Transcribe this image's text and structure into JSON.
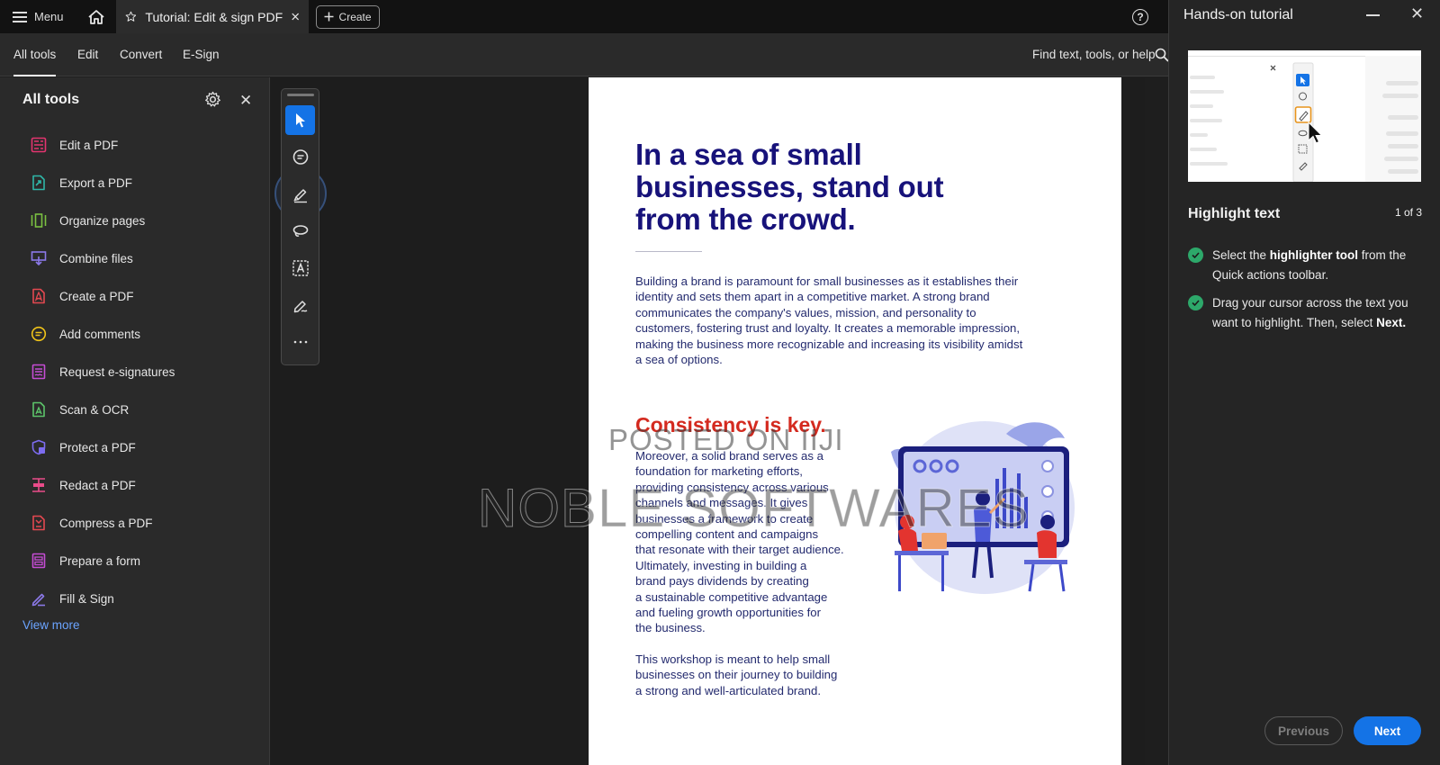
{
  "topbar": {
    "menu_label": "Menu",
    "tab_title": "Tutorial: Edit & sign PDF",
    "create_label": "Create",
    "help_symbol": "?"
  },
  "toolbar": {
    "tabs": [
      {
        "label": "All tools",
        "active": true
      },
      {
        "label": "Edit",
        "active": false
      },
      {
        "label": "Convert",
        "active": false
      },
      {
        "label": "E-Sign",
        "active": false
      }
    ],
    "find_label": "Find text, tools, or help"
  },
  "sidebar": {
    "title": "All tools",
    "items": [
      {
        "label": "Edit a PDF",
        "icon": "edit-pdf-icon",
        "color": "#e3346f"
      },
      {
        "label": "Export a PDF",
        "icon": "export-pdf-icon",
        "color": "#2fb6a7"
      },
      {
        "label": "Organize pages",
        "icon": "organize-pages-icon",
        "color": "#7bc142"
      },
      {
        "label": "Combine files",
        "icon": "combine-files-icon",
        "color": "#8b79e8"
      },
      {
        "label": "Create a PDF",
        "icon": "create-pdf-icon",
        "color": "#e34850"
      },
      {
        "label": "Add comments",
        "icon": "add-comments-icon",
        "color": "#f0c419"
      },
      {
        "label": "Request e-signatures",
        "icon": "request-esignatures-icon",
        "color": "#c54cd4"
      },
      {
        "label": "Scan & OCR",
        "icon": "scan-ocr-icon",
        "color": "#5cc46a"
      },
      {
        "label": "Protect a PDF",
        "icon": "protect-pdf-icon",
        "color": "#7d6cf0"
      },
      {
        "label": "Redact a PDF",
        "icon": "redact-pdf-icon",
        "color": "#e94c8a"
      },
      {
        "label": "Compress a PDF",
        "icon": "compress-pdf-icon",
        "color": "#e34850"
      },
      {
        "label": "Prepare a form",
        "icon": "prepare-form-icon",
        "color": "#c54cd4"
      },
      {
        "label": "Fill & Sign",
        "icon": "fill-sign-icon",
        "color": "#8b79e8"
      }
    ],
    "view_more": "View more"
  },
  "quick_tools": [
    {
      "name": "select-tool",
      "icon": "cursor-icon",
      "selected": true
    },
    {
      "name": "comment-tool",
      "icon": "comment-icon",
      "selected": false
    },
    {
      "name": "highlight-tool",
      "icon": "highlighter-icon",
      "selected": false
    },
    {
      "name": "draw-tool",
      "icon": "lasso-icon",
      "selected": false
    },
    {
      "name": "text-tool",
      "icon": "text-box-icon",
      "selected": false
    },
    {
      "name": "sign-tool",
      "icon": "pen-sign-icon",
      "selected": false
    },
    {
      "name": "more-tools",
      "icon": "more-icon",
      "selected": false
    }
  ],
  "document": {
    "headline": "In a sea of small businesses, stand out from the crowd.",
    "intro": "Building a brand is paramount for small businesses as it establishes their identity and sets them apart in a competitive market. A strong brand communicates the company's values, mission, and personality to customers, fostering trust and loyalty. It creates a memorable impression, making the business more recognizable and increasing its visibility amidst a sea of options.",
    "subhead": "Consistency is key.",
    "body": "Moreover, a solid brand serves as a\nfoundation for marketing efforts,\nproviding consistency across various\nchannels and messages. It gives\nbusinesses a framework to create\ncompelling content and campaigns\nthat resonate with their target audience.\nUltimately, investing in building a\nbrand pays dividends by creating\na sustainable competitive advantage\nand fueling growth opportunities for\nthe business.",
    "closing": "This workshop is meant to help small\nbusinesses on their journey to building\na strong and well-articulated brand."
  },
  "watermark": {
    "line1": "POSTED ON IIJI",
    "line2": "NOBLE SOFTWARES"
  },
  "tutorial": {
    "title": "Hands-on tutorial",
    "step_title": "Highlight text",
    "step_count": "1 of 3",
    "steps": [
      {
        "pre": "Select the ",
        "bold": "highlighter tool",
        "post": " from the Quick actions toolbar."
      },
      {
        "pre": "Drag your cursor across the text you want to highlight. Then, select ",
        "bold": "Next.",
        "post": ""
      }
    ],
    "prev_label": "Previous",
    "next_label": "Next"
  },
  "colors": {
    "accent": "#1473e6",
    "headline": "#17127a",
    "subhead": "#d42a1f",
    "check": "#2da86a"
  }
}
